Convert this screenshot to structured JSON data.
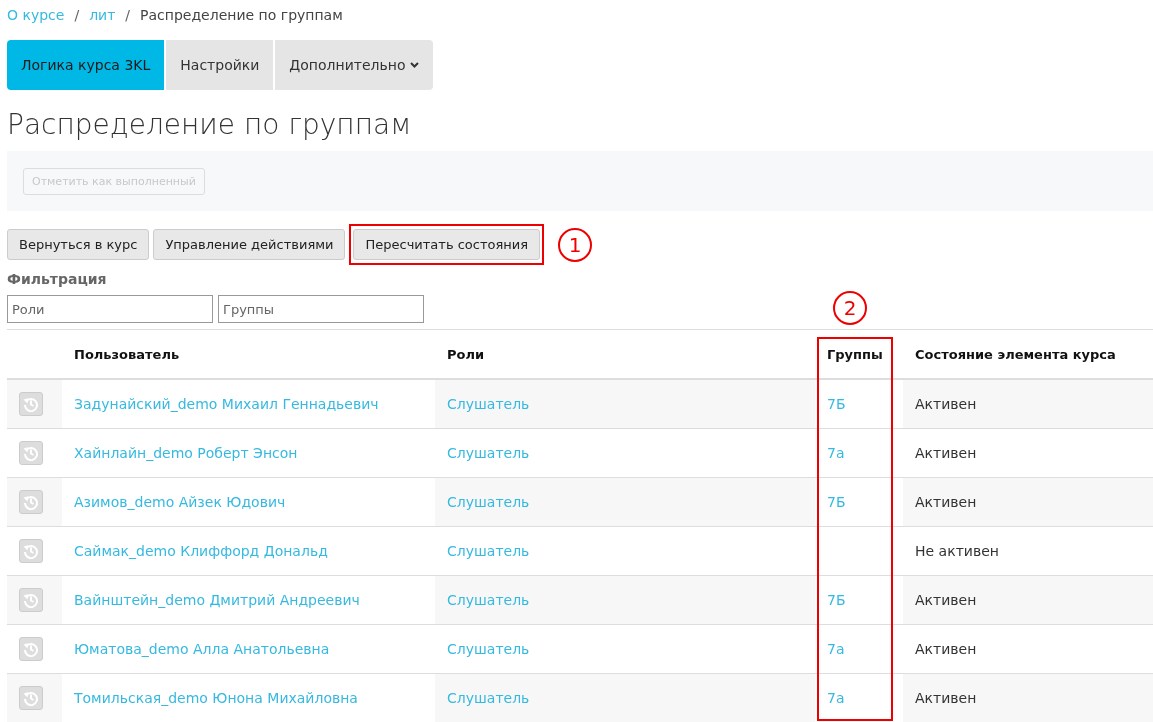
{
  "breadcrumb": {
    "separator": "/",
    "items": [
      {
        "label": "О курсе",
        "link": true
      },
      {
        "label": "лит",
        "link": true
      },
      {
        "label": "Распределение по группам",
        "link": false
      }
    ]
  },
  "tabs": [
    {
      "label": "Логика курса 3KL",
      "selected": true,
      "dropdown": false
    },
    {
      "label": "Настройки",
      "selected": false,
      "dropdown": false
    },
    {
      "label": "Дополнительно",
      "selected": false,
      "dropdown": true
    }
  ],
  "title": "Распределение по группам",
  "completion_button": {
    "label": "Отметить как выполненный",
    "disabled": true
  },
  "actions": [
    {
      "label": "Вернуться в курс",
      "highlighted": false
    },
    {
      "label": "Управление действиями",
      "highlighted": false
    },
    {
      "label": "Пересчитать состояния",
      "highlighted": true,
      "callout": "1"
    }
  ],
  "filter": {
    "heading": "Фильтрация",
    "fields": [
      {
        "placeholder": "Роли"
      },
      {
        "placeholder": "Группы"
      }
    ]
  },
  "table": {
    "columns": [
      {
        "label": "Пользователь",
        "highlighted": false
      },
      {
        "label": "Роли",
        "highlighted": false
      },
      {
        "label": "Группы",
        "highlighted": true,
        "callout": "2"
      },
      {
        "label": "Состояние элемента курса",
        "highlighted": false
      }
    ],
    "rows": [
      {
        "user": "Задунайский_demo Михаил Геннадьевич",
        "role": "Слушатель",
        "group": "7Б",
        "state": "Активен"
      },
      {
        "user": "Хайнлайн_demo Роберт Энсон",
        "role": "Слушатель",
        "group": "7а",
        "state": "Активен"
      },
      {
        "user": "Азимов_demo Айзек Юдович",
        "role": "Слушатель",
        "group": "7Б",
        "state": "Активен"
      },
      {
        "user": "Саймак_demo Клиффорд Дональд",
        "role": "Слушатель",
        "state": "Не активен"
      },
      {
        "user": "Вайнштейн_demo Дмитрий Андреевич",
        "role": "Слушатель",
        "group": "7Б",
        "state": "Активен"
      },
      {
        "user": "Юматова_demo Алла Анатольевна",
        "role": "Слушатель",
        "group": "7а",
        "state": "Активен"
      },
      {
        "user": "Томильская_demo Юнона Михайловна",
        "role": "Слушатель",
        "group": "7а",
        "state": "Активен"
      }
    ]
  }
}
